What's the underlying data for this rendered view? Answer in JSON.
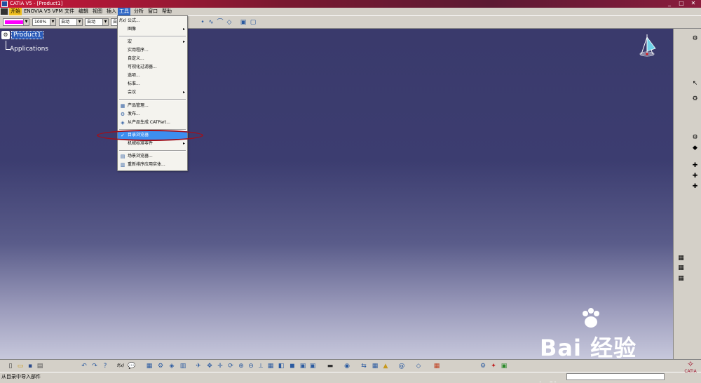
{
  "window": {
    "title": "CATIA V5 - [Product1]",
    "min": "_",
    "max": "□",
    "close": "✕"
  },
  "menubar": {
    "items": [
      "开始",
      "ENOVIA V5 VPM",
      "文件",
      "编辑",
      "视图",
      "插入",
      "工具",
      "分析",
      "窗口",
      "帮助"
    ],
    "active": "工具"
  },
  "toolbar": {
    "color_swatch": "#ff00ff",
    "zoom_value": "100%",
    "combo_auto1": "自动",
    "combo_auto2": "自动",
    "combo_auto3": "自"
  },
  "tree": {
    "root_label": "Product1",
    "child_label": "Applications"
  },
  "tools_menu": {
    "items": [
      {
        "label": "公式...",
        "icon": "fx-icon",
        "glyph": "f(x)",
        "submenu": false
      },
      {
        "label": "图像",
        "icon": "",
        "glyph": "",
        "submenu": true
      },
      {
        "label": "宏",
        "icon": "",
        "glyph": "",
        "submenu": true
      },
      {
        "label": "实用程序...",
        "icon": "",
        "glyph": "",
        "submenu": false
      },
      {
        "label": "自定义...",
        "icon": "",
        "glyph": "",
        "submenu": false
      },
      {
        "label": "可视化过滤器...",
        "icon": "",
        "glyph": "",
        "submenu": false
      },
      {
        "label": "选项...",
        "icon": "",
        "glyph": "",
        "submenu": false
      },
      {
        "label": "标准...",
        "icon": "",
        "glyph": "",
        "submenu": false
      },
      {
        "label": "会议",
        "icon": "",
        "glyph": "",
        "submenu": true
      },
      {
        "label": "产品管理...",
        "icon": "product-manage-icon",
        "glyph": "▦",
        "submenu": false
      },
      {
        "label": "发布...",
        "icon": "publish-icon",
        "glyph": "⚙",
        "submenu": false
      },
      {
        "label": "从产品生成 CATPart...",
        "icon": "generate-part-icon",
        "glyph": "◈",
        "submenu": false
      },
      {
        "label": "目录浏览器",
        "icon": "catalog-browser-icon",
        "glyph": "✓",
        "submenu": false,
        "highlighted": true
      },
      {
        "label": "机械标准零件",
        "icon": "",
        "glyph": "",
        "submenu": true
      },
      {
        "label": "场景浏览器...",
        "icon": "scene-browser-icon",
        "glyph": "▤",
        "submenu": false
      },
      {
        "label": "重新排序应用实体...",
        "icon": "reorder-icon",
        "glyph": "▥",
        "submenu": false
      }
    ]
  },
  "watermark": {
    "brand": "Bai  经验",
    "url": "jingyan.baidu.com"
  },
  "status": {
    "message": "从目录中导入部件"
  },
  "brand_corner": "CATIA"
}
